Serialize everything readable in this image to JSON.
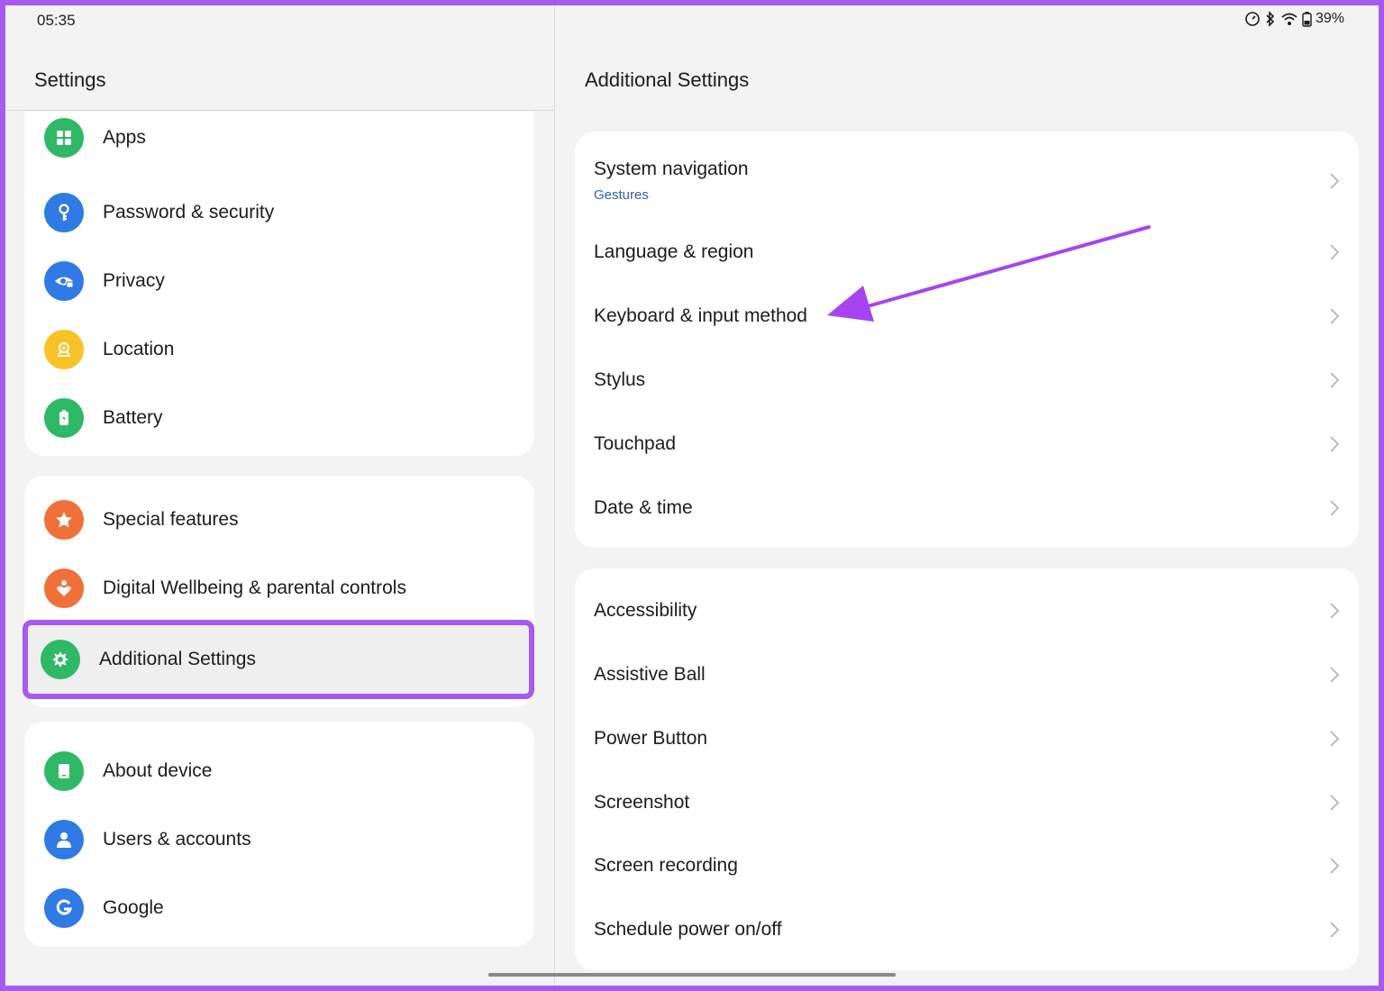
{
  "status_bar": {
    "time": "05:35",
    "battery": "39%",
    "icons": [
      "speedometer-icon",
      "bluetooth-icon",
      "wifi-icon",
      "battery-icon"
    ]
  },
  "left_pane": {
    "title": "Settings",
    "groups": [
      {
        "items": [
          {
            "label": "Apps",
            "icon": "apps-icon",
            "color": "#2fb865"
          },
          {
            "label": "Password & security",
            "icon": "key-icon",
            "color": "#2f7ae5"
          },
          {
            "label": "Privacy",
            "icon": "eye-lock-icon",
            "color": "#2f7ae5"
          },
          {
            "label": "Location",
            "icon": "location-icon",
            "color": "#f7c325"
          },
          {
            "label": "Battery",
            "icon": "battery-icon",
            "color": "#2fb865"
          }
        ]
      },
      {
        "items": [
          {
            "label": "Special features",
            "icon": "star-icon",
            "color": "#f0703a"
          },
          {
            "label": "Digital Wellbeing & parental controls",
            "icon": "heart-person-icon",
            "color": "#f0703a"
          },
          {
            "label": "Additional Settings",
            "icon": "gear-icon",
            "color": "#2fb865",
            "selected": true
          }
        ]
      },
      {
        "items": [
          {
            "label": "About device",
            "icon": "tablet-icon",
            "color": "#2fb865"
          },
          {
            "label": "Users & accounts",
            "icon": "user-icon",
            "color": "#2f7ae5"
          },
          {
            "label": "Google",
            "icon": "google-icon",
            "color": "#2f7ae5"
          }
        ]
      }
    ]
  },
  "right_pane": {
    "title": "Additional Settings",
    "groups": [
      {
        "items": [
          {
            "label": "System navigation",
            "sub": "Gestures"
          },
          {
            "label": "Language & region"
          },
          {
            "label": "Keyboard & input method"
          },
          {
            "label": "Stylus"
          },
          {
            "label": "Touchpad"
          },
          {
            "label": "Date & time"
          }
        ]
      },
      {
        "items": [
          {
            "label": "Accessibility"
          },
          {
            "label": "Assistive Ball"
          },
          {
            "label": "Power Button"
          },
          {
            "label": "Screenshot"
          },
          {
            "label": "Screen recording"
          },
          {
            "label": "Schedule power on/off"
          }
        ]
      }
    ]
  },
  "colors": {
    "accent_annotation": "#a65af0",
    "subtitle_blue": "#2f5fb3"
  }
}
